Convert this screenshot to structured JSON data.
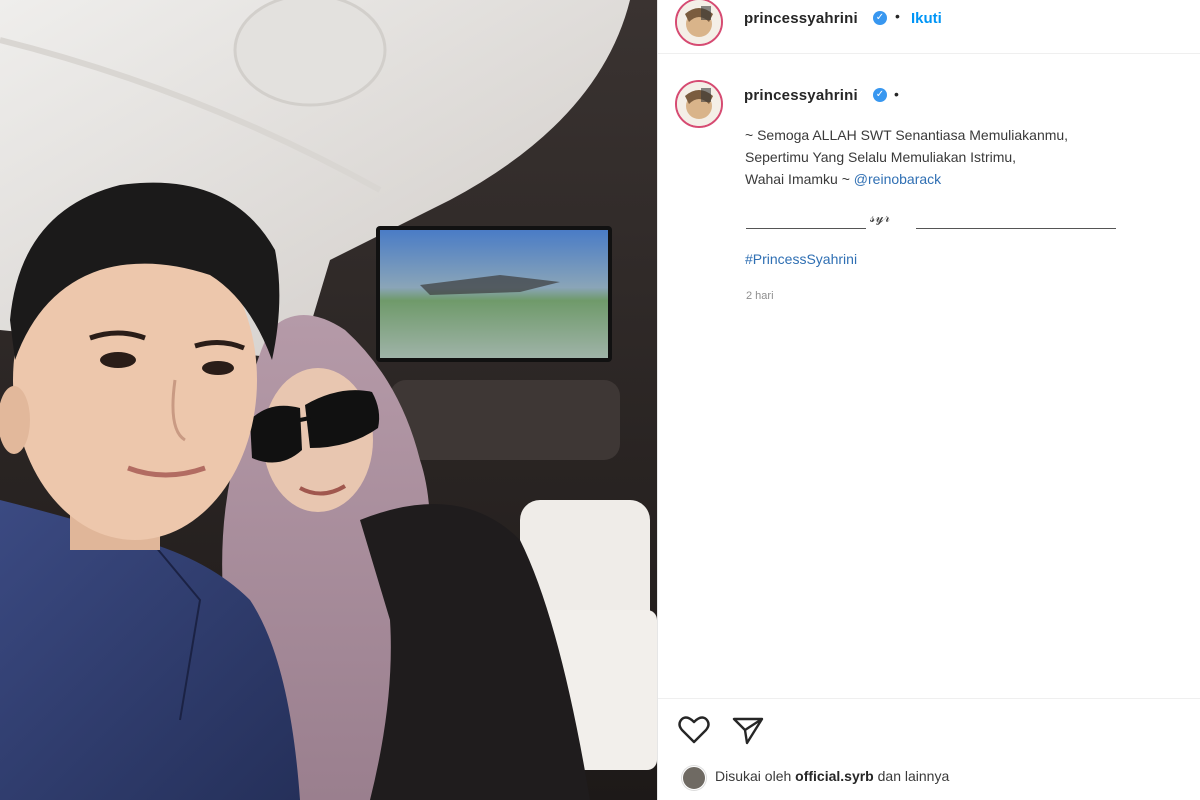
{
  "post": {
    "username": "princessyahrini",
    "verified_mark": "✓",
    "separator": "•",
    "follow_label": "Ikuti",
    "caption": {
      "line1": "~ Semoga ALLAH SWT Senantiasa Memuliakanmu,",
      "line2": "Sepertimu Yang Selalu Memuliakan Istrimu,",
      "line3_prefix": "Wahai Imamku ~ ",
      "mention": "@reinobarack",
      "signature": "𝓈𝓎𝓇",
      "hashtag": "#PrincessSyahrini"
    },
    "timestamp": "2 hari",
    "likes": {
      "prefix": "Disukai oleh ",
      "user": "official.syrb",
      "suffix": " dan lainnya"
    }
  },
  "icons": {
    "like": "heart-icon",
    "share": "paper-plane-icon",
    "verified": "verified-badge-icon"
  },
  "colors": {
    "link_blue": "#0095f6",
    "hashtag_blue": "#2f6fb3",
    "verified_blue": "#3897f0",
    "avatar_ring": "#d64b72"
  }
}
